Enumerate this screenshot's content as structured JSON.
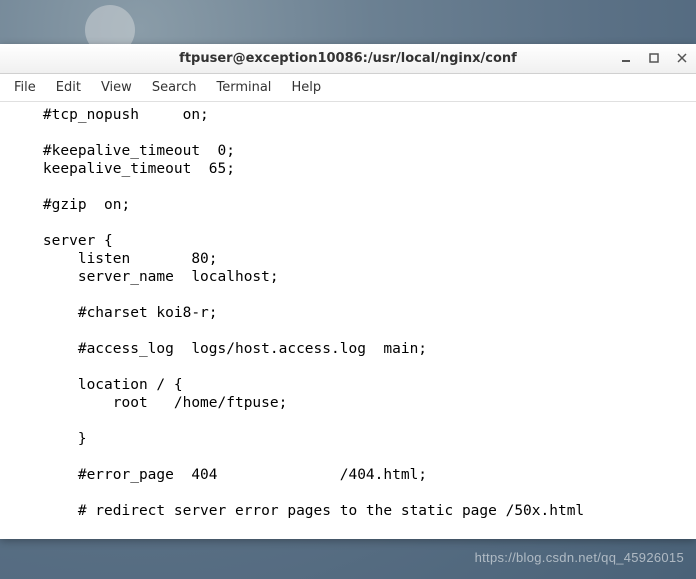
{
  "window": {
    "title": "ftpuser@exception10086:/usr/local/nginx/conf"
  },
  "menubar": {
    "items": [
      "File",
      "Edit",
      "View",
      "Search",
      "Terminal",
      "Help"
    ]
  },
  "editor": {
    "content": "    #tcp_nopush     on;\n\n    #keepalive_timeout  0;\n    keepalive_timeout  65;\n\n    #gzip  on;\n\n    server {\n        listen       80;\n        server_name  localhost;\n\n        #charset koi8-r;\n\n        #access_log  logs/host.access.log  main;\n\n        location / {\n            root   /home/ftpuse;\n\n        }\n\n        #error_page  404              /404.html;\n\n        # redirect server error pages to the static page /50x.html"
  },
  "watermark": "https://blog.csdn.net/qq_45926015"
}
